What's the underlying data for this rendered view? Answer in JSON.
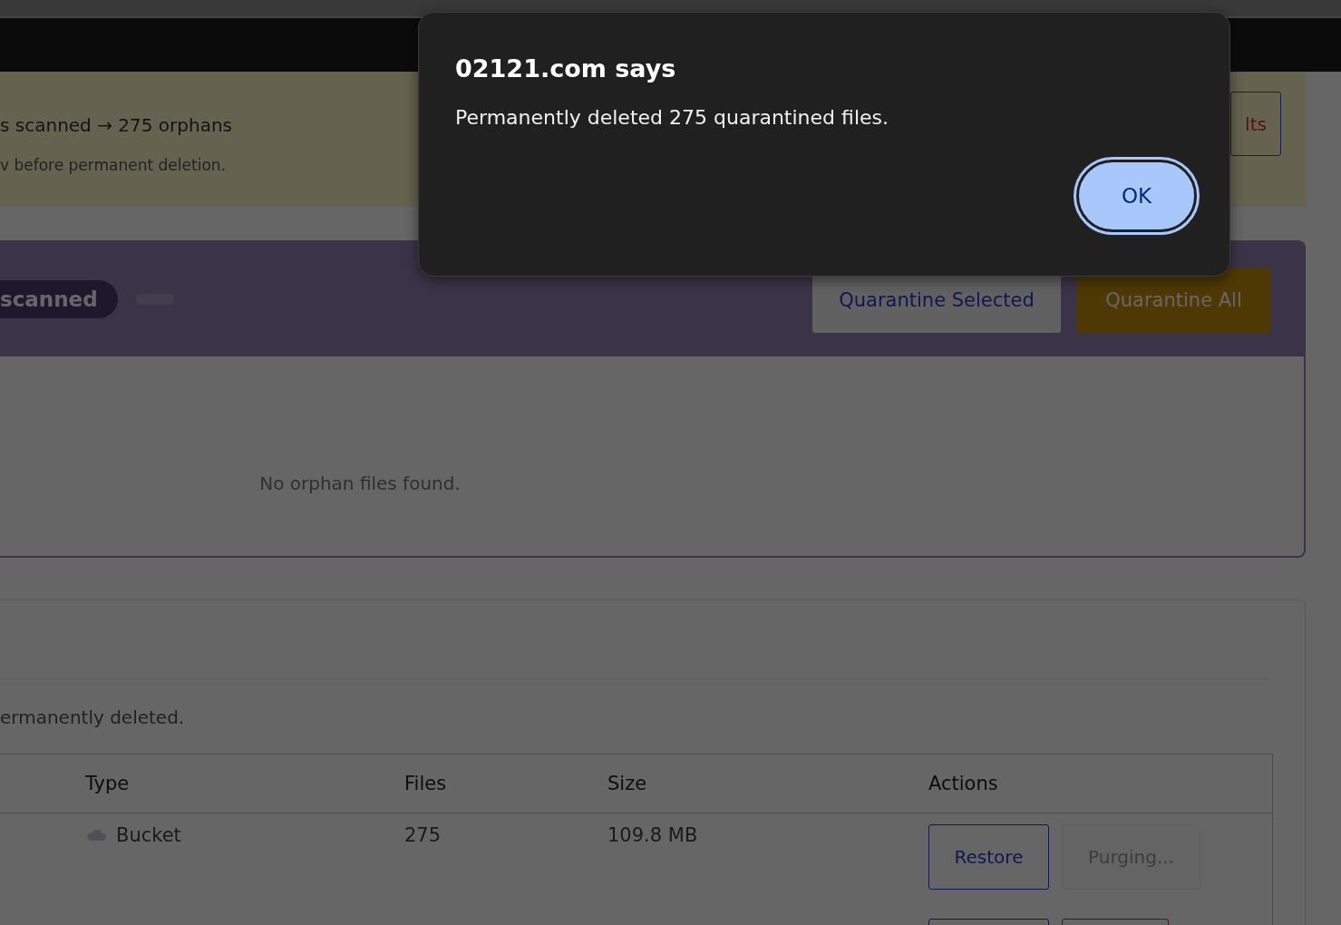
{
  "banner": {
    "summary": "s scanned → 275 orphans",
    "note": "v before permanent deletion.",
    "button": "lts"
  },
  "scan_card": {
    "pill": "scanned",
    "buttons": [
      {
        "kind": "secondary",
        "label": "Quarantine Selected",
        "disabled": false
      },
      {
        "kind": "primary",
        "label": "Quarantine All",
        "disabled": true
      }
    ],
    "empty_message": "No orphan files found."
  },
  "quarantine_card": {
    "description": "ermanently deleted.",
    "table": {
      "columns": [
        "Type",
        "Files",
        "Size",
        "Actions"
      ],
      "rows": [
        {
          "type": "Bucket",
          "files": "275",
          "size": "109.8 MB",
          "actions": [
            {
              "kind": "restore",
              "label": "Restore",
              "disabled": false
            },
            {
              "kind": "purge",
              "label": "Purging...",
              "disabled": true
            }
          ]
        },
        {
          "actions": [
            {
              "kind": "restore"
            },
            {
              "kind": "purge"
            }
          ]
        }
      ]
    }
  },
  "dialog": {
    "title": "02121.com says",
    "message": "Permanently deleted 275 quarantined files.",
    "button": "OK"
  }
}
